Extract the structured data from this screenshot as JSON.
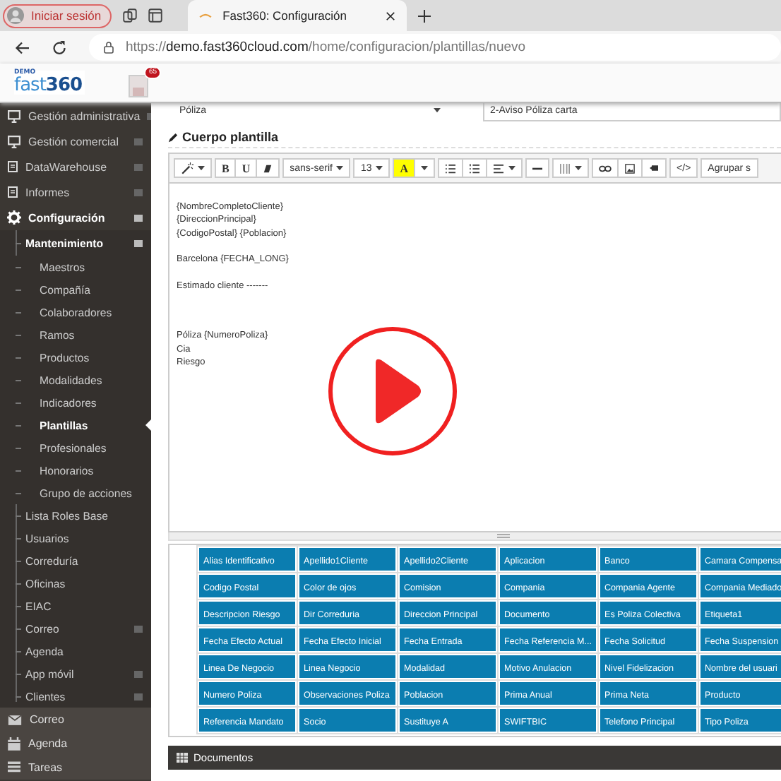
{
  "browser": {
    "profile_button": "Iniciar sesión",
    "tab": {
      "title": "Fast360: Configuración"
    },
    "url": {
      "scheme": "https://",
      "host": "demo.fast360cloud.com",
      "path": "/home/configuracion/plantillas/nuevo"
    }
  },
  "header": {
    "logo": {
      "tag": "DEMO",
      "word": "fast",
      "number": "360"
    },
    "notifications_badge": "65"
  },
  "sidebar": {
    "items": [
      {
        "label": "Gestión administrativa",
        "kind": "monitor",
        "selected": false,
        "expanded": false
      },
      {
        "label": "Gestión comercial",
        "kind": "monitor",
        "selected": false,
        "expanded": false
      },
      {
        "label": "DataWarehouse",
        "kind": "document",
        "selected": false,
        "expanded": false
      },
      {
        "label": "Informes",
        "kind": "document",
        "selected": false,
        "expanded": false
      },
      {
        "label": "Configuración",
        "kind": "gear",
        "selected": false,
        "expanded": true,
        "children": [
          {
            "label": "Mantenimiento",
            "selected": false,
            "expanded": true,
            "children": [
              {
                "label": "Maestros",
                "selected": false
              },
              {
                "label": "Compañía",
                "selected": false
              },
              {
                "label": "Colaboradores",
                "selected": false
              },
              {
                "label": "Ramos",
                "selected": false
              },
              {
                "label": "Productos",
                "selected": false
              },
              {
                "label": "Modalidades",
                "selected": false
              },
              {
                "label": "Indicadores",
                "selected": false
              },
              {
                "label": "Plantillas",
                "selected": true
              },
              {
                "label": "Profesionales",
                "selected": false
              },
              {
                "label": "Honorarios",
                "selected": false
              },
              {
                "label": "Grupo de acciones",
                "selected": false
              }
            ]
          },
          {
            "label": "Lista Roles Base",
            "selected": false
          },
          {
            "label": "Usuarios",
            "selected": false
          },
          {
            "label": "Correduría",
            "selected": false
          },
          {
            "label": "Oficinas",
            "selected": false
          },
          {
            "label": "EIAC",
            "selected": false
          },
          {
            "label": "Correo",
            "selected": false,
            "expanded": false
          },
          {
            "label": "Agenda",
            "selected": false
          },
          {
            "label": "App móvil",
            "selected": false,
            "expanded": false
          },
          {
            "label": "Clientes",
            "selected": false,
            "expanded": false
          }
        ]
      }
    ],
    "bottom_items": [
      {
        "label": "Correo",
        "kind": "mail",
        "selected": false
      },
      {
        "label": "Agenda",
        "kind": "calendar",
        "selected": false
      },
      {
        "label": "Tareas",
        "kind": "tasks",
        "selected": false
      }
    ]
  },
  "form": {
    "type_label": "Póliza",
    "template_value": "2-Aviso Póliza carta"
  },
  "editor": {
    "title": "Cuerpo plantilla",
    "toolbar": [
      [
        {
          "kind": "wand",
          "caret": true
        }
      ],
      [
        {
          "kind": "bold",
          "label": "B"
        },
        {
          "kind": "underline",
          "label": "U"
        },
        {
          "kind": "eraser"
        }
      ],
      [
        {
          "kind": "select",
          "label": "sans-serif",
          "caret": true
        }
      ],
      [
        {
          "kind": "select",
          "label": "13",
          "caret": true
        }
      ],
      [
        {
          "kind": "color",
          "label": "A"
        },
        {
          "kind": "caret"
        }
      ],
      [
        {
          "kind": "ul"
        },
        {
          "kind": "ol"
        },
        {
          "kind": "align",
          "caret": true
        }
      ],
      [
        {
          "kind": "rule"
        }
      ],
      [
        {
          "kind": "table",
          "caret": true
        }
      ],
      [
        {
          "kind": "link"
        },
        {
          "kind": "image"
        },
        {
          "kind": "video"
        }
      ],
      [
        {
          "kind": "code",
          "label": "</>"
        }
      ],
      [
        {
          "kind": "select",
          "label": "Agrupar s"
        }
      ]
    ],
    "blocks": [
      [
        "{NombreCompletoCliente}",
        "{DireccionPrincipal}",
        "{CodigoPostal} {Poblacion}"
      ],
      [
        "Barcelona {FECHA_LONG}"
      ],
      [
        "Estimado cliente -------"
      ],
      [
        "Póliza {NumeroPoliza}",
        "Cia",
        "Riesgo"
      ]
    ]
  },
  "fields": {
    "rows": [
      [
        "Alias Identificativo",
        "Apellido1Cliente",
        "Apellido2Cliente",
        "Aplicacion",
        "Banco",
        "Camara Compensa"
      ],
      [
        "Codigo Postal",
        "Color de ojos",
        "Comision",
        "Compania",
        "Compania Agente",
        "Compania Mediado"
      ],
      [
        "Descripcion Riesgo",
        "Dir Correduria",
        "Direccion Principal",
        "Documento",
        "Es Poliza Colectiva",
        "Etiqueta1"
      ],
      [
        "Fecha Efecto Actual",
        "Fecha Efecto Inicial",
        "Fecha Entrada",
        "Fecha Referencia M...",
        "Fecha Solicitud",
        "Fecha Suspension"
      ],
      [
        "Linea De Negocio",
        "Linea Negocio",
        "Modalidad",
        "Motivo Anulacion",
        "Nivel Fidelizacion",
        "Nombre del usuari"
      ],
      [
        "Numero Poliza",
        "Observaciones Poliza",
        "Poblacion",
        "Prima Anual",
        "Prima Neta",
        "Producto"
      ],
      [
        "Referencia Mandato",
        "Socio",
        "Sustituye A",
        "SWIFTBIC",
        "Telefono Principal",
        "Tipo Poliza"
      ]
    ]
  },
  "documents": {
    "title": "Documentos"
  }
}
